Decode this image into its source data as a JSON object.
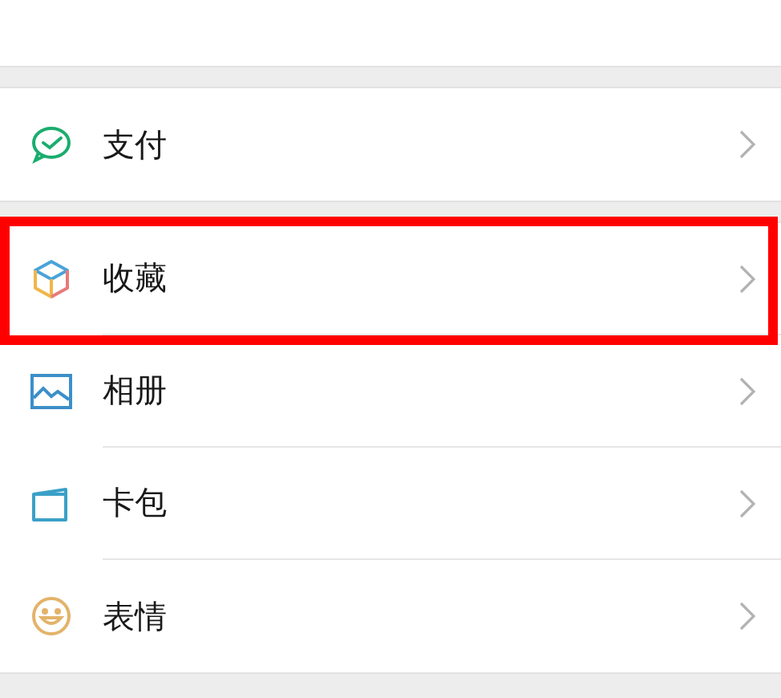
{
  "sections": [
    {
      "items": [
        {
          "label": "支付",
          "highlighted": false
        }
      ]
    },
    {
      "items": [
        {
          "label": "收藏",
          "highlighted": true
        },
        {
          "label": "相册",
          "highlighted": false
        },
        {
          "label": "卡包",
          "highlighted": false
        },
        {
          "label": "表情",
          "highlighted": false
        }
      ]
    }
  ]
}
